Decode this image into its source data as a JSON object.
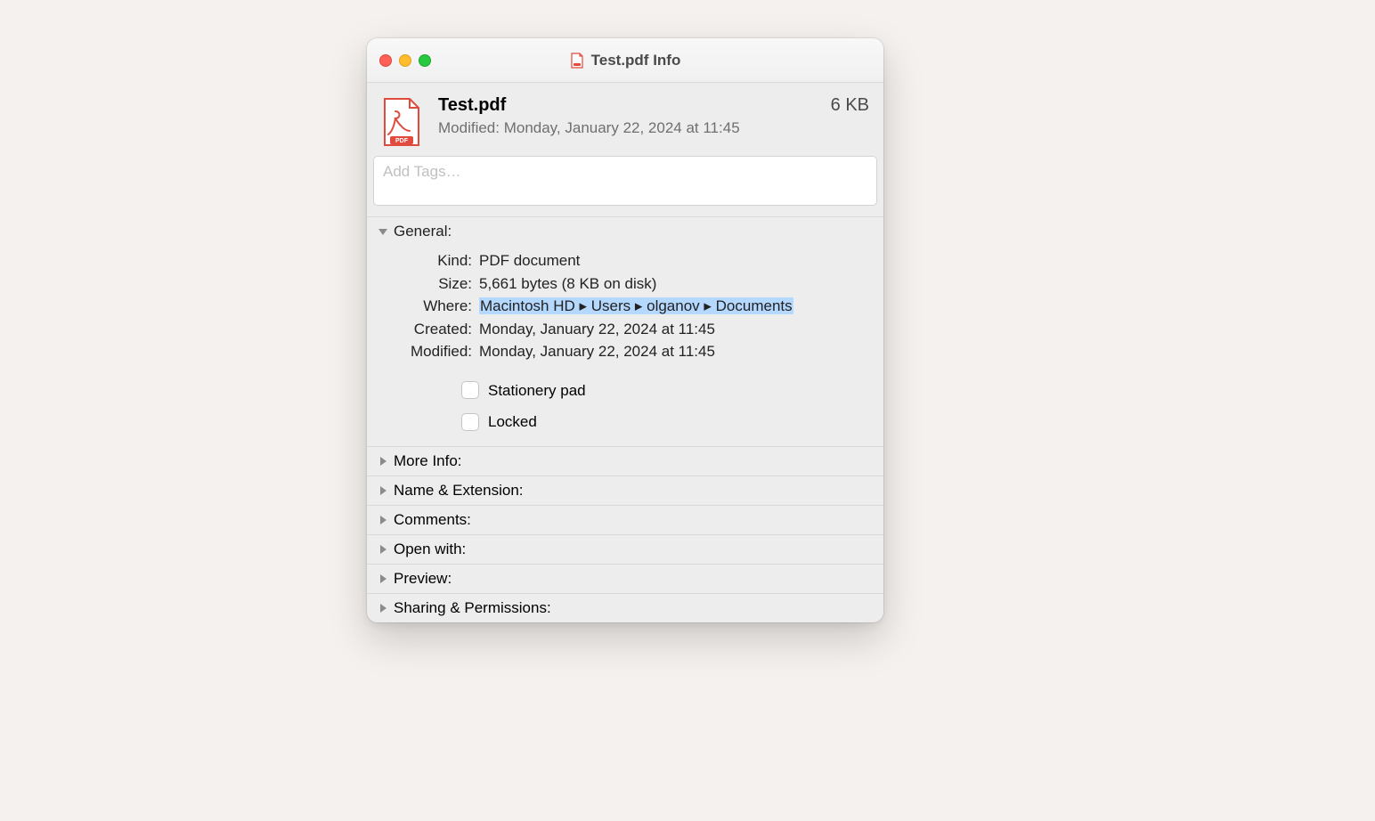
{
  "window": {
    "title": "Test.pdf Info"
  },
  "file": {
    "name": "Test.pdf",
    "size_short": "6 KB",
    "modified_line": "Modified: Monday, January 22, 2024 at 11:45"
  },
  "tags": {
    "placeholder": "Add Tags…"
  },
  "sections": {
    "general": {
      "label": "General:",
      "kind_label": "Kind:",
      "kind_value": "PDF document",
      "size_label": "Size:",
      "size_value": "5,661 bytes (8 KB on disk)",
      "where_label": "Where:",
      "where_value": "Macintosh HD ▸ Users ▸ olganov ▸ Documents",
      "created_label": "Created:",
      "created_value": "Monday, January 22, 2024 at 11:45",
      "modified_label": "Modified:",
      "modified_value": "Monday, January 22, 2024 at 11:45",
      "stationery_label": "Stationery pad",
      "locked_label": "Locked"
    },
    "more_info": "More Info:",
    "name_ext": "Name & Extension:",
    "comments": "Comments:",
    "open_with": "Open with:",
    "preview": "Preview:",
    "sharing": "Sharing & Permissions:"
  }
}
